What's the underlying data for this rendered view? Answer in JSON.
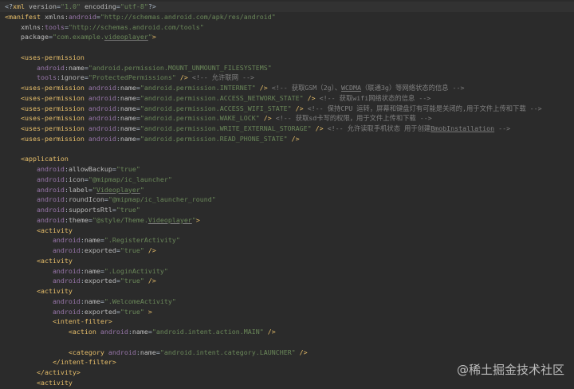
{
  "lines": [
    {
      "segs": [
        [
          "p",
          "<?"
        ],
        [
          "s",
          "xml"
        ],
        [
          "a",
          " version"
        ],
        [
          "p",
          "="
        ],
        [
          "v",
          "\"1.0\""
        ],
        [
          "a",
          " encoding"
        ],
        [
          "p",
          "="
        ],
        [
          "v",
          "\"utf-8\""
        ],
        [
          "p",
          "?>"
        ]
      ]
    },
    {
      "segs": [
        [
          "s",
          "<manifest"
        ],
        [
          "a",
          " xmlns:"
        ],
        [
          "n",
          "android"
        ],
        [
          "p",
          "="
        ],
        [
          "v",
          "\"http://schemas.android.com/apk/res/android\""
        ]
      ]
    },
    {
      "segs": [
        [
          "a",
          "    xmlns:"
        ],
        [
          "n",
          "tools"
        ],
        [
          "p",
          "="
        ],
        [
          "v",
          "\"http://schemas.android.com/tools\""
        ]
      ]
    },
    {
      "segs": [
        [
          "a",
          "    package"
        ],
        [
          "p",
          "="
        ],
        [
          "v",
          "\"com.example."
        ],
        [
          "vu",
          "videoplayer"
        ],
        [
          "v",
          "\""
        ],
        [
          "s",
          ">"
        ]
      ]
    },
    {
      "segs": []
    },
    {
      "segs": [
        [
          "s",
          "    <uses-permission"
        ]
      ]
    },
    {
      "segs": [
        [
          "n",
          "        android"
        ],
        [
          "p",
          ":"
        ],
        [
          "a",
          "name"
        ],
        [
          "p",
          "="
        ],
        [
          "v",
          "\"android.permission.MOUNT_UNMOUNT_FILESYSTEMS\""
        ]
      ]
    },
    {
      "segs": [
        [
          "n",
          "        tools"
        ],
        [
          "p",
          ":"
        ],
        [
          "a",
          "ignore"
        ],
        [
          "p",
          "="
        ],
        [
          "v",
          "\"ProtectedPermissions\""
        ],
        [
          "s",
          " />"
        ],
        [
          "c",
          " <!-- 允许联网 -->"
        ]
      ]
    },
    {
      "segs": [
        [
          "s",
          "    <uses-permission"
        ],
        [
          "n",
          " android"
        ],
        [
          "p",
          ":"
        ],
        [
          "a",
          "name"
        ],
        [
          "p",
          "="
        ],
        [
          "v",
          "\"android.permission.INTERNET\""
        ],
        [
          "s",
          " />"
        ],
        [
          "c",
          " <!-- 获取GSM（2g）、"
        ],
        [
          "cu",
          "WCDMA"
        ],
        [
          "c",
          "（联通3g）等网络状态的信息 -->"
        ]
      ]
    },
    {
      "segs": [
        [
          "s",
          "    <uses-permission"
        ],
        [
          "n",
          " android"
        ],
        [
          "p",
          ":"
        ],
        [
          "a",
          "name"
        ],
        [
          "p",
          "="
        ],
        [
          "v",
          "\"android.permission.ACCESS_NETWORK_STATE\""
        ],
        [
          "s",
          " />"
        ],
        [
          "c",
          " <!-- 获取wifi网络状态的信息 -->"
        ]
      ]
    },
    {
      "segs": [
        [
          "s",
          "    <uses-permission"
        ],
        [
          "n",
          " android"
        ],
        [
          "p",
          ":"
        ],
        [
          "a",
          "name"
        ],
        [
          "p",
          "="
        ],
        [
          "v",
          "\"android.permission.ACCESS_WIFI_STATE\""
        ],
        [
          "s",
          " />"
        ],
        [
          "c",
          " <!-- 保持CPU 运转，屏幕和键盘灯有可能是关闭的,用于文件上传和下载 -->"
        ]
      ]
    },
    {
      "segs": [
        [
          "s",
          "    <uses-permission"
        ],
        [
          "n",
          " android"
        ],
        [
          "p",
          ":"
        ],
        [
          "a",
          "name"
        ],
        [
          "p",
          "="
        ],
        [
          "v",
          "\"android.permission.WAKE_LOCK\""
        ],
        [
          "s",
          " />"
        ],
        [
          "c",
          " <!-- 获取sd卡写的权限，用于文件上传和下载 -->"
        ]
      ]
    },
    {
      "segs": [
        [
          "s",
          "    <uses-permission"
        ],
        [
          "n",
          " android"
        ],
        [
          "p",
          ":"
        ],
        [
          "a",
          "name"
        ],
        [
          "p",
          "="
        ],
        [
          "v",
          "\"android.permission.WRITE_EXTERNAL_STORAGE\""
        ],
        [
          "s",
          " />"
        ],
        [
          "c",
          " <!-- 允许读取手机状态 用于创建"
        ],
        [
          "cu",
          "BmobInstallation"
        ],
        [
          "c",
          " -->"
        ]
      ]
    },
    {
      "segs": [
        [
          "s",
          "    <uses-permission"
        ],
        [
          "n",
          " android"
        ],
        [
          "p",
          ":"
        ],
        [
          "a",
          "name"
        ],
        [
          "p",
          "="
        ],
        [
          "v",
          "\"android.permission.READ_PHONE_STATE\""
        ],
        [
          "s",
          " />"
        ]
      ]
    },
    {
      "segs": []
    },
    {
      "segs": [
        [
          "s",
          "    <application"
        ]
      ]
    },
    {
      "segs": [
        [
          "n",
          "        android"
        ],
        [
          "p",
          ":"
        ],
        [
          "a",
          "allowBackup"
        ],
        [
          "p",
          "="
        ],
        [
          "v",
          "\"true\""
        ]
      ]
    },
    {
      "segs": [
        [
          "n",
          "        android"
        ],
        [
          "p",
          ":"
        ],
        [
          "a",
          "icon"
        ],
        [
          "p",
          "="
        ],
        [
          "v",
          "\"@mipmap/ic_launcher\""
        ]
      ]
    },
    {
      "segs": [
        [
          "n",
          "        android"
        ],
        [
          "p",
          ":"
        ],
        [
          "a",
          "label"
        ],
        [
          "p",
          "="
        ],
        [
          "v",
          "\""
        ],
        [
          "vu",
          "Videoplayer"
        ],
        [
          "v",
          "\""
        ]
      ]
    },
    {
      "segs": [
        [
          "n",
          "        android"
        ],
        [
          "p",
          ":"
        ],
        [
          "a",
          "roundIcon"
        ],
        [
          "p",
          "="
        ],
        [
          "v",
          "\"@mipmap/ic_launcher_round\""
        ]
      ]
    },
    {
      "segs": [
        [
          "n",
          "        android"
        ],
        [
          "p",
          ":"
        ],
        [
          "a",
          "supportsRtl"
        ],
        [
          "p",
          "="
        ],
        [
          "v",
          "\"true\""
        ]
      ]
    },
    {
      "segs": [
        [
          "n",
          "        android"
        ],
        [
          "p",
          ":"
        ],
        [
          "a",
          "theme"
        ],
        [
          "p",
          "="
        ],
        [
          "v",
          "\"@style/Theme."
        ],
        [
          "vu",
          "Videoplayer"
        ],
        [
          "v",
          "\""
        ],
        [
          "s",
          ">"
        ]
      ]
    },
    {
      "segs": [
        [
          "s",
          "        <activity"
        ]
      ]
    },
    {
      "segs": [
        [
          "n",
          "            android"
        ],
        [
          "p",
          ":"
        ],
        [
          "a",
          "name"
        ],
        [
          "p",
          "="
        ],
        [
          "v",
          "\".RegisterActivity\""
        ]
      ]
    },
    {
      "segs": [
        [
          "n",
          "            android"
        ],
        [
          "p",
          ":"
        ],
        [
          "a",
          "exported"
        ],
        [
          "p",
          "="
        ],
        [
          "v",
          "\"true\""
        ],
        [
          "s",
          " />"
        ]
      ]
    },
    {
      "segs": [
        [
          "s",
          "        <activity"
        ]
      ]
    },
    {
      "segs": [
        [
          "n",
          "            android"
        ],
        [
          "p",
          ":"
        ],
        [
          "a",
          "name"
        ],
        [
          "p",
          "="
        ],
        [
          "v",
          "\".LoginActivity\""
        ]
      ]
    },
    {
      "segs": [
        [
          "n",
          "            android"
        ],
        [
          "p",
          ":"
        ],
        [
          "a",
          "exported"
        ],
        [
          "p",
          "="
        ],
        [
          "v",
          "\"true\""
        ],
        [
          "s",
          " />"
        ]
      ]
    },
    {
      "segs": [
        [
          "s",
          "        <activity"
        ]
      ]
    },
    {
      "segs": [
        [
          "n",
          "            android"
        ],
        [
          "p",
          ":"
        ],
        [
          "a",
          "name"
        ],
        [
          "p",
          "="
        ],
        [
          "v",
          "\".WelcomeActivity\""
        ]
      ]
    },
    {
      "segs": [
        [
          "n",
          "            android"
        ],
        [
          "p",
          ":"
        ],
        [
          "a",
          "exported"
        ],
        [
          "p",
          "="
        ],
        [
          "v",
          "\"true\""
        ],
        [
          "s",
          " >"
        ]
      ]
    },
    {
      "segs": [
        [
          "s",
          "            <intent-filter>"
        ]
      ]
    },
    {
      "segs": [
        [
          "s",
          "                <action"
        ],
        [
          "n",
          " android"
        ],
        [
          "p",
          ":"
        ],
        [
          "a",
          "name"
        ],
        [
          "p",
          "="
        ],
        [
          "v",
          "\"android.intent.action.MAIN\""
        ],
        [
          "s",
          " />"
        ]
      ]
    },
    {
      "segs": []
    },
    {
      "segs": [
        [
          "s",
          "                <category"
        ],
        [
          "n",
          " android"
        ],
        [
          "p",
          ":"
        ],
        [
          "a",
          "name"
        ],
        [
          "p",
          "="
        ],
        [
          "v",
          "\"android.intent.category.LAUNCHER\""
        ],
        [
          "s",
          " />"
        ]
      ]
    },
    {
      "segs": [
        [
          "s",
          "            </intent-filter>"
        ]
      ]
    },
    {
      "segs": [
        [
          "s",
          "        </activity>"
        ]
      ]
    },
    {
      "segs": [
        [
          "s",
          "        <activity"
        ]
      ]
    }
  ],
  "watermark": "@稀土掘金技术社区"
}
